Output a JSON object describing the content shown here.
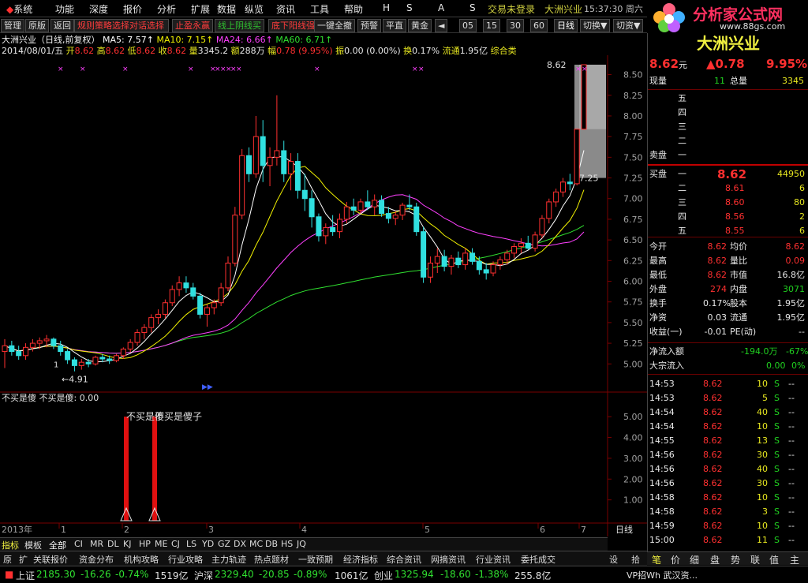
{
  "menu": {
    "items": [
      "系统",
      "功能",
      "深度",
      "报价",
      "分析",
      "扩展",
      "数据",
      "纵览",
      "资讯",
      "工具",
      "帮助"
    ],
    "letters": [
      "H",
      "S",
      "A",
      "S"
    ],
    "trade_status": "交易未登录",
    "stock_title": "大洲兴业",
    "clock": "15:37:30 周六"
  },
  "toolbar": {
    "manage": "管理",
    "original": "原版",
    "back": "返回",
    "promo1": "规则策略选择对话选择",
    "promo2": "止盈永赢",
    "promo3": "线上阴线买",
    "promo4": "底下阳线强",
    "one_click": "一键全撤",
    "alert": "预警",
    "flat": "平直",
    "gold": "黄金",
    "arrow": "◄",
    "periods": [
      "05",
      "15",
      "30",
      "60"
    ],
    "daily": "日线",
    "switch": "切换▼",
    "switch_stock": "切资▼"
  },
  "logo": {
    "text": "分析家公式网",
    "url": "www.88gs.com",
    "stock_name": "大洲兴业"
  },
  "chart_info": {
    "title": "大洲兴业（日线,前复权）",
    "ma5_label": "MA5:",
    "ma5": "7.57↑",
    "ma10_label": "MA10:",
    "ma10": "7.15↑",
    "ma24_label": "MA24:",
    "ma24": "6.66↑",
    "ma60_label": "MA60:",
    "ma60": "6.71↑",
    "date": "2014/08/01/五",
    "open_label": "开",
    "open": "8.62",
    "high_label": "高",
    "high": "8.62",
    "low_label": "低",
    "low": "8.62",
    "close_label": "收",
    "close": "8.62",
    "volume_label": "量",
    "volume": "3345.2",
    "amount_label": "额",
    "amount": "288万",
    "range_label": "幅",
    "range": "0.78 (9.95%)",
    "amp_label": "振",
    "amp": "0.00 (0.00%)",
    "turnover_label": "换",
    "turnover": "0.17%",
    "float_label": "流通",
    "float": "1.95亿",
    "category": "综合类"
  },
  "chart_data": [
    {
      "type": "candlestick",
      "title": "大洲兴业（日线,前复权）",
      "y_ticks": [
        "8.50",
        "8.25",
        "8.00",
        "7.75",
        "7.50",
        "7.25",
        "7.00",
        "6.75",
        "6.50",
        "6.25",
        "6.00",
        "5.75",
        "5.50",
        "5.25",
        "5.00"
      ],
      "ylim": [
        4.85,
        8.62
      ],
      "x_ticks": [
        "2013年",
        "1",
        "2",
        "3",
        "4",
        "5",
        "6",
        "7"
      ],
      "annotations": [
        "8.62",
        "7.25",
        "4.91",
        "1"
      ],
      "ohlc": [
        [
          5.15,
          5.3,
          4.95,
          5.22
        ],
        [
          5.22,
          5.28,
          5.1,
          5.15
        ],
        [
          5.15,
          5.22,
          5.05,
          5.1
        ],
        [
          5.1,
          5.25,
          5.05,
          5.2
        ],
        [
          5.2,
          5.3,
          5.15,
          5.25
        ],
        [
          5.25,
          5.32,
          5.18,
          5.28
        ],
        [
          5.28,
          5.35,
          5.2,
          5.3
        ],
        [
          5.3,
          5.32,
          5.18,
          5.22
        ],
        [
          5.22,
          5.28,
          5.1,
          5.15
        ],
        [
          5.15,
          5.18,
          5.0,
          5.05
        ],
        [
          5.05,
          5.08,
          4.91,
          4.98
        ],
        [
          4.98,
          5.06,
          4.93,
          5.02
        ],
        [
          5.02,
          5.06,
          4.96,
          5.0
        ],
        [
          5.0,
          5.1,
          4.98,
          5.08
        ],
        [
          5.08,
          5.12,
          5.02,
          5.06
        ],
        [
          5.06,
          5.1,
          5.0,
          5.04
        ],
        [
          5.04,
          5.12,
          5.02,
          5.1
        ],
        [
          5.1,
          5.2,
          5.06,
          5.18
        ],
        [
          5.18,
          5.3,
          5.14,
          5.26
        ],
        [
          5.26,
          5.42,
          5.22,
          5.38
        ],
        [
          5.38,
          5.48,
          5.3,
          5.44
        ],
        [
          5.44,
          5.6,
          5.38,
          5.56
        ],
        [
          5.56,
          5.66,
          5.48,
          5.6
        ],
        [
          5.6,
          5.78,
          5.55,
          5.74
        ],
        [
          5.74,
          5.95,
          5.7,
          5.9
        ],
        [
          5.9,
          6.06,
          5.82,
          5.98
        ],
        [
          5.98,
          6.06,
          5.86,
          5.92
        ],
        [
          5.92,
          5.98,
          5.78,
          5.82
        ],
        [
          5.82,
          5.86,
          5.55,
          5.6
        ],
        [
          5.6,
          5.72,
          5.45,
          5.68
        ],
        [
          5.68,
          5.78,
          5.6,
          5.74
        ],
        [
          5.74,
          5.98,
          5.7,
          5.92
        ],
        [
          5.92,
          6.3,
          5.88,
          6.22
        ],
        [
          6.22,
          6.9,
          6.18,
          6.8
        ],
        [
          6.8,
          7.6,
          6.75,
          7.52
        ],
        [
          7.52,
          7.62,
          7.2,
          7.3
        ],
        [
          7.3,
          8.0,
          7.25,
          7.75
        ],
        [
          7.75,
          7.95,
          7.2,
          7.4
        ],
        [
          7.4,
          7.62,
          7.15,
          7.5
        ],
        [
          7.5,
          8.25,
          7.4,
          7.58
        ],
        [
          7.58,
          7.7,
          7.2,
          7.3
        ],
        [
          7.3,
          7.55,
          7.1,
          7.45
        ],
        [
          7.45,
          7.55,
          7.0,
          7.1
        ],
        [
          7.1,
          7.3,
          6.85,
          7.0
        ],
        [
          7.0,
          7.1,
          6.65,
          6.78
        ],
        [
          6.78,
          6.82,
          6.48,
          6.55
        ],
        [
          6.55,
          6.7,
          6.45,
          6.65
        ],
        [
          6.65,
          6.8,
          6.55,
          6.6
        ],
        [
          6.6,
          6.82,
          6.52,
          6.75
        ],
        [
          6.75,
          6.96,
          6.7,
          6.9
        ],
        [
          6.9,
          7.0,
          6.8,
          6.86
        ],
        [
          6.86,
          7.0,
          6.82,
          6.96
        ],
        [
          6.96,
          7.1,
          6.86,
          6.9
        ],
        [
          6.9,
          7.05,
          6.8,
          6.98
        ],
        [
          6.98,
          7.04,
          6.78,
          6.82
        ],
        [
          6.82,
          6.9,
          6.7,
          6.76
        ],
        [
          6.76,
          6.85,
          6.68,
          6.8
        ],
        [
          6.8,
          6.95,
          6.74,
          6.92
        ],
        [
          6.92,
          7.05,
          6.86,
          6.9
        ],
        [
          6.9,
          6.95,
          6.55,
          6.6
        ],
        [
          6.6,
          6.66,
          5.98,
          6.05
        ],
        [
          6.05,
          6.3,
          5.98,
          6.22
        ],
        [
          6.22,
          6.4,
          6.1,
          6.3
        ],
        [
          6.3,
          6.38,
          6.12,
          6.18
        ],
        [
          6.18,
          6.32,
          6.08,
          6.28
        ],
        [
          6.28,
          6.36,
          6.16,
          6.2
        ],
        [
          6.2,
          6.4,
          6.14,
          6.34
        ],
        [
          6.34,
          6.4,
          6.2,
          6.24
        ],
        [
          6.24,
          6.3,
          6.08,
          6.14
        ],
        [
          6.14,
          6.22,
          6.02,
          6.1
        ],
        [
          6.1,
          6.24,
          6.06,
          6.2
        ],
        [
          6.2,
          6.3,
          6.14,
          6.26
        ],
        [
          6.26,
          6.38,
          6.2,
          6.34
        ],
        [
          6.34,
          6.46,
          6.28,
          6.42
        ],
        [
          6.42,
          6.52,
          6.34,
          6.46
        ],
        [
          6.46,
          6.55,
          6.38,
          6.4
        ],
        [
          6.4,
          6.6,
          6.36,
          6.56
        ],
        [
          6.56,
          6.8,
          6.52,
          6.76
        ],
        [
          6.76,
          7.0,
          6.7,
          6.96
        ],
        [
          6.96,
          7.12,
          6.9,
          7.08
        ],
        [
          7.08,
          7.25,
          7.02,
          7.2
        ],
        [
          7.2,
          7.3,
          7.1,
          7.18
        ],
        [
          7.18,
          7.84,
          7.16,
          7.84
        ],
        [
          7.84,
          8.62,
          7.84,
          8.62
        ]
      ]
    },
    {
      "type": "bar",
      "title": "不买是傻",
      "series": [
        {
          "name": "不买是傻",
          "values": [
            0.0
          ]
        }
      ],
      "y_ticks": [
        "5.00",
        "4.00",
        "3.00",
        "2.00",
        "1.00"
      ],
      "ylim": [
        0,
        5.5
      ],
      "annotations": [
        "不买是傻",
        "不买是傻子"
      ]
    }
  ],
  "indicator": {
    "title": "不买是傻",
    "value_text": "不买是傻: 0.00",
    "label1": "不买是傻",
    "label2": "不买是傻子"
  },
  "axis": {
    "year_label": "2013年",
    "months": [
      "1",
      "2",
      "3",
      "4",
      "5",
      "6",
      "7"
    ],
    "period": "日线"
  },
  "quote": {
    "price": "8.62",
    "price_unit": "元",
    "change": "▲0.78",
    "change_pct": "9.95%",
    "vol_now_label": "现量",
    "vol_now": "11",
    "vol_total_label": "总量",
    "vol_total": "3345",
    "sell_levels": [
      "五",
      "四",
      "三",
      "二",
      "一"
    ],
    "sell_label": "卖盘",
    "buy_label": "买盘",
    "buy_levels": [
      {
        "level": "一",
        "price": "8.62",
        "vol": "44950"
      },
      {
        "level": "二",
        "price": "8.61",
        "vol": "6"
      },
      {
        "level": "三",
        "price": "8.60",
        "vol": "80"
      },
      {
        "level": "四",
        "price": "8.56",
        "vol": "2"
      },
      {
        "level": "五",
        "price": "8.55",
        "vol": "6"
      }
    ],
    "stats": [
      {
        "l1": "今开",
        "v1": "8.62",
        "l2": "均价",
        "v2": "8.62"
      },
      {
        "l1": "最高",
        "v1": "8.62",
        "l2": "量比",
        "v2": "0.09"
      },
      {
        "l1": "最低",
        "v1": "8.62",
        "l2": "市值",
        "v2": "16.8亿"
      },
      {
        "l1": "外盘",
        "v1": "274",
        "l2": "内盘",
        "v2": "3071"
      },
      {
        "l1": "换手",
        "v1": "0.17%",
        "l2": "股本",
        "v2": "1.95亿"
      },
      {
        "l1": "净资",
        "v1": "0.03",
        "l2": "流通",
        "v2": "1.95亿"
      },
      {
        "l1": "收益(一)",
        "v1": "-0.01",
        "l2": "PE(动)",
        "v2": "--"
      }
    ],
    "netflow_label": "净流入额",
    "netflow": "-194.0万",
    "netflow_pct": "-67%",
    "bigflow_label": "大宗流入",
    "bigflow": "0.00",
    "bigflow_pct": "0%"
  },
  "ticks": [
    {
      "t": "14:53",
      "p": "8.62",
      "v": "10",
      "s": "S",
      "x": "--"
    },
    {
      "t": "14:53",
      "p": "8.62",
      "v": "5",
      "s": "S",
      "x": "--"
    },
    {
      "t": "14:54",
      "p": "8.62",
      "v": "40",
      "s": "S",
      "x": "--"
    },
    {
      "t": "14:54",
      "p": "8.62",
      "v": "10",
      "s": "S",
      "x": "--"
    },
    {
      "t": "14:55",
      "p": "8.62",
      "v": "13",
      "s": "S",
      "x": "--"
    },
    {
      "t": "14:56",
      "p": "8.62",
      "v": "30",
      "s": "S",
      "x": "--"
    },
    {
      "t": "14:56",
      "p": "8.62",
      "v": "40",
      "s": "S",
      "x": "--"
    },
    {
      "t": "14:56",
      "p": "8.62",
      "v": "30",
      "s": "S",
      "x": "--"
    },
    {
      "t": "14:58",
      "p": "8.62",
      "v": "10",
      "s": "S",
      "x": "--"
    },
    {
      "t": "14:58",
      "p": "8.62",
      "v": "3",
      "s": "S",
      "x": "--"
    },
    {
      "t": "14:59",
      "p": "8.62",
      "v": "10",
      "s": "S",
      "x": "--"
    },
    {
      "t": "15:00",
      "p": "8.62",
      "v": "11",
      "s": "S",
      "x": "--"
    }
  ],
  "rp_tabs": [
    "笔",
    "价",
    "细",
    "盘",
    "势",
    "联",
    "值",
    "主"
  ],
  "bottom_tabs": [
    "指标",
    "模板",
    "全部",
    "CI",
    "MR",
    "DL",
    "KJ",
    "HP",
    "ME",
    "CJ",
    "LS",
    "YD",
    "GZ",
    "DX",
    "MC",
    "DB",
    "HS",
    "JQ"
  ],
  "bottom_nav": [
    "原",
    "扩",
    "关联报价",
    "资金分布",
    "机构攻略",
    "行业攻略",
    "主力轨迹",
    "热点题材",
    "一致预期",
    "经济指标",
    "综合资讯",
    "网摘资讯",
    "行业资讯",
    "委托成交",
    "设",
    "拾"
  ],
  "status": {
    "sh_label": "上证",
    "sh_val": "2185.30",
    "sh_chg": "-16.26",
    "sh_pct": "-0.74%",
    "sh_amt": "1519亿",
    "sz_label": "沪深",
    "sz_val": "2329.40",
    "sz_chg": "-20.85",
    "sz_pct": "-0.89%",
    "sz_amt": "1061亿",
    "cy_label": "创业",
    "cy_val": "1325.94",
    "cy_chg": "-18.60",
    "cy_pct": "-1.38%",
    "cy_amt": "255.8亿",
    "news": "VP招Wh 武汉资..."
  },
  "colors": {
    "up": "#ff3030",
    "down": "#30e0e0",
    "ma5": "#ffffff",
    "ma10": "#f0f000",
    "ma24": "#ff40ff",
    "ma60": "#30e030",
    "bg": "#000000"
  }
}
